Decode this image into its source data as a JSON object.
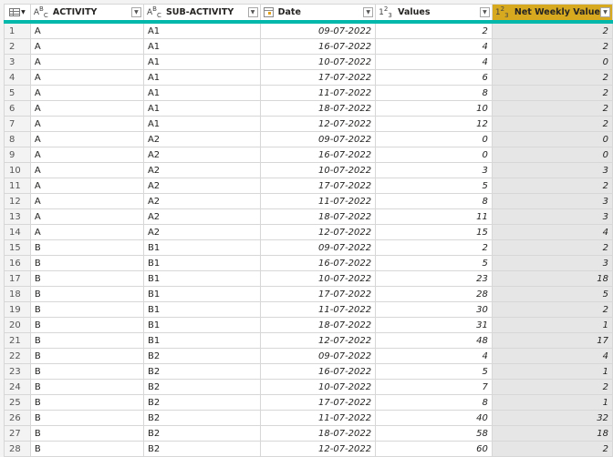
{
  "columns": [
    {
      "name": "ACTIVITY",
      "type_icon": "abc-text-type-icon",
      "type_label": "ABC"
    },
    {
      "name": "SUB-ACTIVITY",
      "type_icon": "abc-text-type-icon",
      "type_label": "ABC"
    },
    {
      "name": "Date",
      "type_icon": "calendar-date-type-icon",
      "type_label": ""
    },
    {
      "name": "Values",
      "type_icon": "123-number-type-icon",
      "type_label": "123"
    },
    {
      "name": "Net Weekly Value",
      "type_icon": "123-number-type-icon",
      "type_label": "123",
      "selected": true
    }
  ],
  "colors": {
    "quality_bar": "#01b8aa",
    "selected_header": "#d7a91f",
    "selected_column_bg": "#e6e6e6"
  },
  "rows": [
    {
      "n": "1",
      "activity": "A",
      "sub": "A1",
      "date": "09-07-2022",
      "values": "2",
      "net": "2"
    },
    {
      "n": "2",
      "activity": "A",
      "sub": "A1",
      "date": "16-07-2022",
      "values": "4",
      "net": "2"
    },
    {
      "n": "3",
      "activity": "A",
      "sub": "A1",
      "date": "10-07-2022",
      "values": "4",
      "net": "0"
    },
    {
      "n": "4",
      "activity": "A",
      "sub": "A1",
      "date": "17-07-2022",
      "values": "6",
      "net": "2"
    },
    {
      "n": "5",
      "activity": "A",
      "sub": "A1",
      "date": "11-07-2022",
      "values": "8",
      "net": "2"
    },
    {
      "n": "6",
      "activity": "A",
      "sub": "A1",
      "date": "18-07-2022",
      "values": "10",
      "net": "2"
    },
    {
      "n": "7",
      "activity": "A",
      "sub": "A1",
      "date": "12-07-2022",
      "values": "12",
      "net": "2"
    },
    {
      "n": "8",
      "activity": "A",
      "sub": "A2",
      "date": "09-07-2022",
      "values": "0",
      "net": "0"
    },
    {
      "n": "9",
      "activity": "A",
      "sub": "A2",
      "date": "16-07-2022",
      "values": "0",
      "net": "0"
    },
    {
      "n": "10",
      "activity": "A",
      "sub": "A2",
      "date": "10-07-2022",
      "values": "3",
      "net": "3"
    },
    {
      "n": "11",
      "activity": "A",
      "sub": "A2",
      "date": "17-07-2022",
      "values": "5",
      "net": "2"
    },
    {
      "n": "12",
      "activity": "A",
      "sub": "A2",
      "date": "11-07-2022",
      "values": "8",
      "net": "3"
    },
    {
      "n": "13",
      "activity": "A",
      "sub": "A2",
      "date": "18-07-2022",
      "values": "11",
      "net": "3"
    },
    {
      "n": "14",
      "activity": "A",
      "sub": "A2",
      "date": "12-07-2022",
      "values": "15",
      "net": "4"
    },
    {
      "n": "15",
      "activity": "B",
      "sub": "B1",
      "date": "09-07-2022",
      "values": "2",
      "net": "2"
    },
    {
      "n": "16",
      "activity": "B",
      "sub": "B1",
      "date": "16-07-2022",
      "values": "5",
      "net": "3"
    },
    {
      "n": "17",
      "activity": "B",
      "sub": "B1",
      "date": "10-07-2022",
      "values": "23",
      "net": "18"
    },
    {
      "n": "18",
      "activity": "B",
      "sub": "B1",
      "date": "17-07-2022",
      "values": "28",
      "net": "5"
    },
    {
      "n": "19",
      "activity": "B",
      "sub": "B1",
      "date": "11-07-2022",
      "values": "30",
      "net": "2"
    },
    {
      "n": "20",
      "activity": "B",
      "sub": "B1",
      "date": "18-07-2022",
      "values": "31",
      "net": "1"
    },
    {
      "n": "21",
      "activity": "B",
      "sub": "B1",
      "date": "12-07-2022",
      "values": "48",
      "net": "17"
    },
    {
      "n": "22",
      "activity": "B",
      "sub": "B2",
      "date": "09-07-2022",
      "values": "4",
      "net": "4"
    },
    {
      "n": "23",
      "activity": "B",
      "sub": "B2",
      "date": "16-07-2022",
      "values": "5",
      "net": "1"
    },
    {
      "n": "24",
      "activity": "B",
      "sub": "B2",
      "date": "10-07-2022",
      "values": "7",
      "net": "2"
    },
    {
      "n": "25",
      "activity": "B",
      "sub": "B2",
      "date": "17-07-2022",
      "values": "8",
      "net": "1"
    },
    {
      "n": "26",
      "activity": "B",
      "sub": "B2",
      "date": "11-07-2022",
      "values": "40",
      "net": "32"
    },
    {
      "n": "27",
      "activity": "B",
      "sub": "B2",
      "date": "18-07-2022",
      "values": "58",
      "net": "18"
    },
    {
      "n": "28",
      "activity": "B",
      "sub": "B2",
      "date": "12-07-2022",
      "values": "60",
      "net": "2"
    }
  ]
}
